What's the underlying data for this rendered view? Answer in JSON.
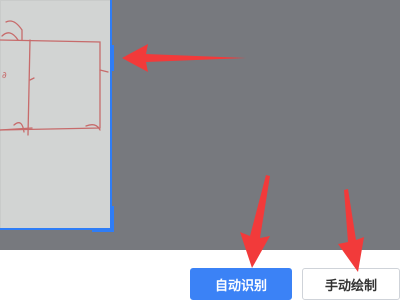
{
  "buttons": {
    "auto_recognize": "自动识别",
    "manual_draw": "手动绘制"
  },
  "colors": {
    "workspace_bg": "#77797e",
    "accent_blue": "#2f7df6",
    "annotation_red": "#f23a3a"
  }
}
